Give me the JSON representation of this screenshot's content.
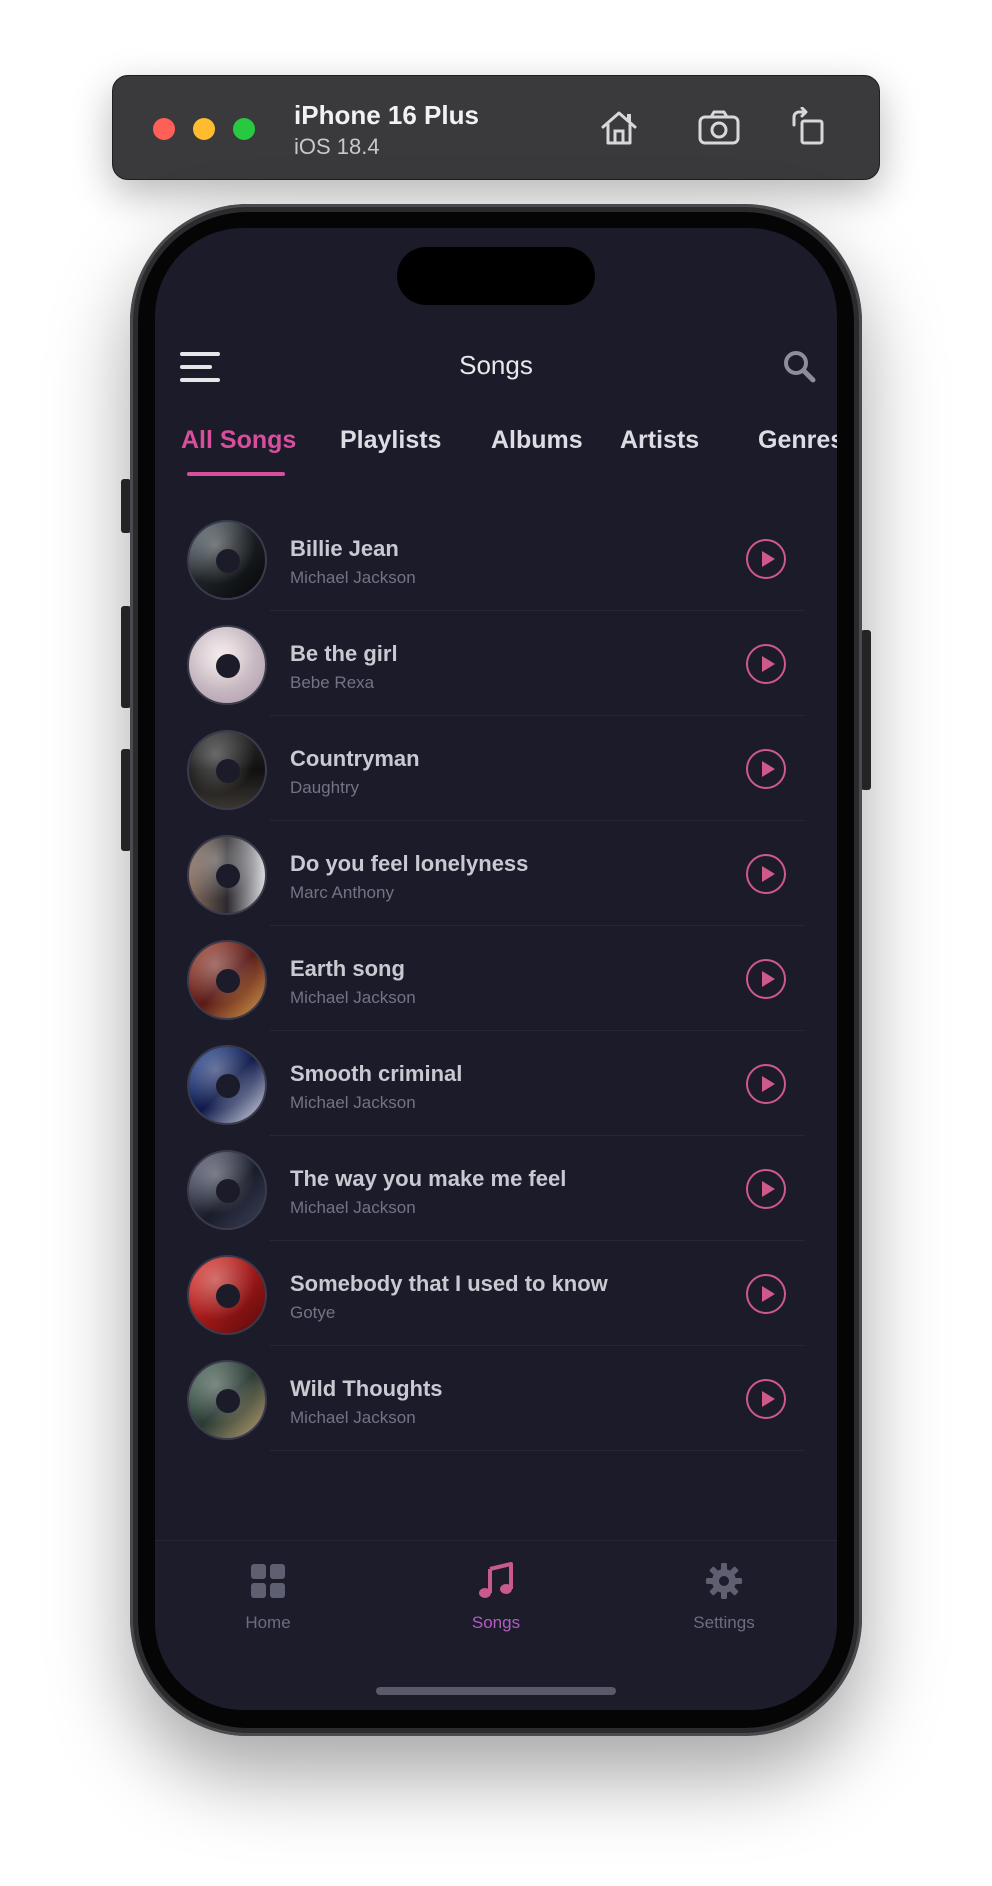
{
  "simulator": {
    "device_name": "iPhone 16 Plus",
    "os_version": "iOS 18.4",
    "buttons": [
      "home-icon",
      "screenshot-icon",
      "rotate-icon"
    ]
  },
  "header": {
    "title": "Songs",
    "menu_icon": "hamburger-menu-icon",
    "search_icon": "search-icon"
  },
  "tabs": [
    {
      "label": "All Songs",
      "active": true
    },
    {
      "label": "Playlists",
      "active": false
    },
    {
      "label": "Albums",
      "active": false
    },
    {
      "label": "Artists",
      "active": false
    },
    {
      "label": "Genres",
      "active": false
    }
  ],
  "songs": [
    {
      "title": "Billie Jean",
      "artist": "Michael Jackson"
    },
    {
      "title": "Be the girl",
      "artist": "Bebe Rexa"
    },
    {
      "title": "Countryman",
      "artist": "Daughtry"
    },
    {
      "title": "Do you feel lonelyness",
      "artist": "Marc Anthony"
    },
    {
      "title": "Earth song",
      "artist": "Michael Jackson"
    },
    {
      "title": "Smooth criminal",
      "artist": "Michael Jackson"
    },
    {
      "title": "The way you make me feel",
      "artist": "Michael Jackson"
    },
    {
      "title": "Somebody that I used to know",
      "artist": "Gotye"
    },
    {
      "title": "Wild Thoughts",
      "artist": "Michael Jackson"
    }
  ],
  "bottom_nav": [
    {
      "label": "Home",
      "icon": "grid-icon",
      "active": false
    },
    {
      "label": "Songs",
      "icon": "music-note-icon",
      "active": true
    },
    {
      "label": "Settings",
      "icon": "gear-icon",
      "active": false
    }
  ],
  "colors": {
    "background": "#1b1b2a",
    "accent": "#d74f9c",
    "nav_active": "#b45cc4"
  }
}
